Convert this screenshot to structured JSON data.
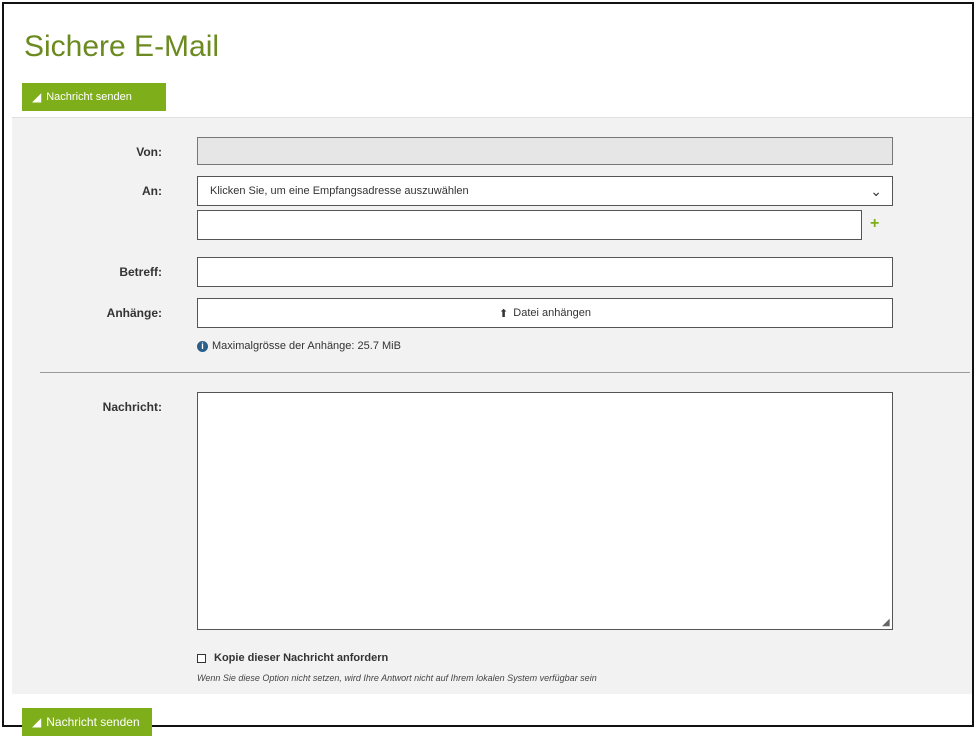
{
  "page": {
    "title": "Sichere E-Mail"
  },
  "toolbar": {
    "send_label_top": "Nachricht senden",
    "send_label_bottom": "Nachricht senden"
  },
  "form": {
    "from": {
      "label": "Von:",
      "value": ""
    },
    "to": {
      "label": "An:",
      "select_placeholder": "Klicken Sie, um eine Empfangsadresse auszuwählen",
      "extra_value": "",
      "add_symbol": "+"
    },
    "subject": {
      "label": "Betreff:",
      "value": ""
    },
    "attachments": {
      "label": "Anhänge:",
      "button_label": "Datei anhängen",
      "max_size_info": "Maximalgrösse der Anhänge: 25.7 MiB"
    },
    "message": {
      "label": "Nachricht:",
      "value": ""
    },
    "copy": {
      "checkbox_label": "Kopie dieser Nachricht anfordern",
      "checked": false,
      "hint": "Wenn Sie diese Option nicht setzen, wird Ihre Antwort nicht auf Ihrem lokalen System verfügbar sein"
    }
  },
  "icons": {
    "send": "paper-plane-icon",
    "upload": "upload-icon",
    "info": "info-circle-icon",
    "chevron": "chevron-down-icon",
    "add": "plus-icon"
  },
  "colors": {
    "accent": "#7fae1b",
    "title": "#6b8a1f",
    "panel_bg": "#f2f2f2",
    "readonly_bg": "#e6e6e6"
  }
}
